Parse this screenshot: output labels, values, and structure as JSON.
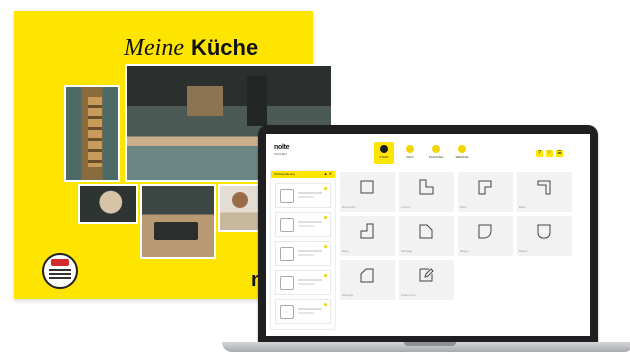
{
  "catalog": {
    "title_italic": "Meine",
    "title_bold": "Küche",
    "brand": "nol"
  },
  "app": {
    "logo": "nolte",
    "logo_sub": "KÜCHEN",
    "nav": [
      {
        "label": "START",
        "active": true
      },
      {
        "label": "INFO",
        "active": false
      },
      {
        "label": "PLANUNG",
        "active": false
      },
      {
        "label": "SERVICE",
        "active": false
      }
    ],
    "header_buttons": [
      "?",
      "♡",
      "☰"
    ],
    "sidebar": {
      "heading": "Küchenplanung",
      "icons": "▲ ✕",
      "item_count": 5
    },
    "tiles": [
      {
        "label": "Raumform",
        "icon": "square"
      },
      {
        "label": "L-Form",
        "icon": "l-shape"
      },
      {
        "label": "Ecke",
        "icon": "corner-tr"
      },
      {
        "label": "Ecke",
        "icon": "corner-tr2"
      },
      {
        "label": "Ecke",
        "icon": "corner-bl"
      },
      {
        "label": "Schräge",
        "icon": "bevel-tr"
      },
      {
        "label": "Bogen",
        "icon": "round-r"
      },
      {
        "label": "Bogen",
        "icon": "round-b"
      },
      {
        "label": "Schräge",
        "icon": "bevel-tl"
      },
      {
        "label": "Freie Form",
        "icon": "pencil"
      }
    ]
  },
  "colors": {
    "brand_yellow": "#fde500",
    "laptop_frame": "#1f1f21",
    "tile_bg": "#f2f2f2"
  }
}
